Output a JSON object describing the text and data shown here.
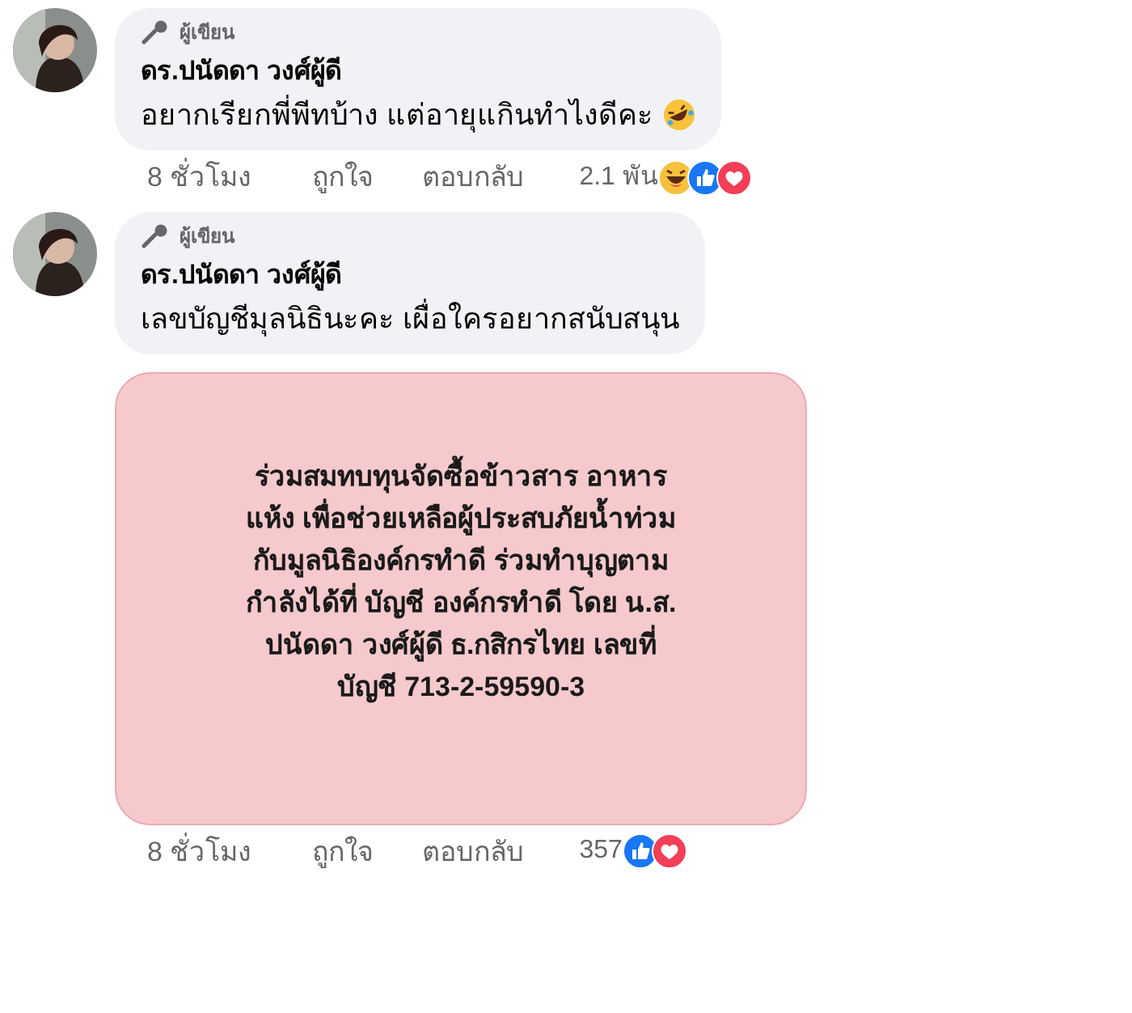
{
  "comments": [
    {
      "badge": "ผู้เขียน",
      "author": "ดร.ปนัดดา วงศ์ผู้ดี",
      "text": "อยากเรียกพี่พีทบ้าง แต่อายุแกินทำไงดีคะ",
      "trailing_emoji": {
        "kind": "rofl"
      },
      "time": "8 ชั่วโมง",
      "like": "ถูกใจ",
      "reply": "ตอบกลับ",
      "reaction_count": "2.1 พัน",
      "reactions": [
        {
          "kind": "haha"
        },
        {
          "kind": "like"
        },
        {
          "kind": "love"
        }
      ]
    },
    {
      "badge": "ผู้เขียน",
      "author": "ดร.ปนัดดา วงศ์ผู้ดี",
      "text": "เลขบัญชีมุลนิธินะคะ เผื่อใครอยากสนับสนุน",
      "attachment": {
        "lines": [
          "ร่วมสมทบทุนจัดซื้อข้าวสาร อาหาร",
          "แห้ง เพื่อช่วยเหลือผู้ประสบภัยน้ำท่วม",
          "กับมูลนิธิองค์กรทำดี ร่วมทำบุญตาม",
          "กำลังได้ที่ บัญชี องค์กรทำดี โดย น.ส.",
          "ปนัดดา วงศ์ผู้ดี ธ.กสิกรไทย เลขที่",
          "บัญชี 713-2-59590-3"
        ]
      },
      "time": "8 ชั่วโมง",
      "like": "ถูกใจ",
      "reply": "ตอบกลับ",
      "reaction_count": "357",
      "reactions": [
        {
          "kind": "like"
        },
        {
          "kind": "love"
        }
      ]
    }
  ]
}
